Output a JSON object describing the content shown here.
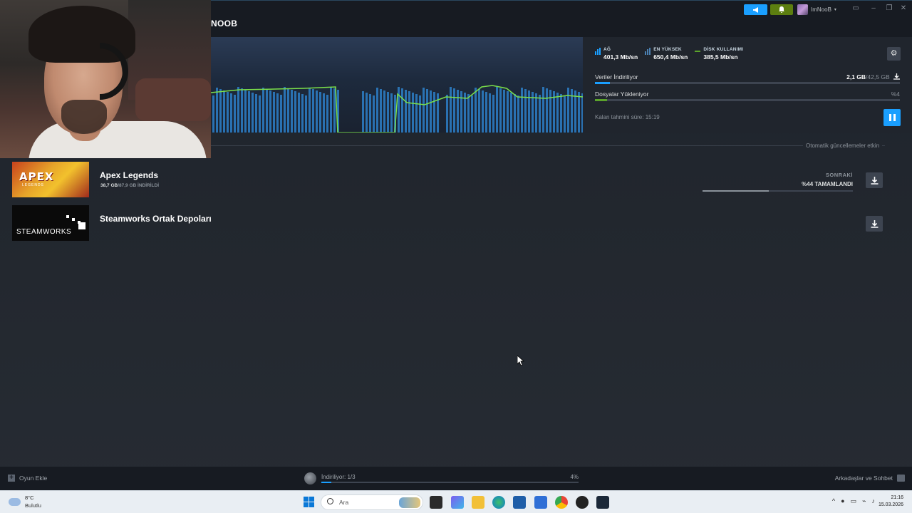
{
  "window": {
    "title": "NOOB",
    "user_name": "ImNooB",
    "colors": {
      "accent": "#1a9fff",
      "green": "#5ba32b",
      "bell_bg": "#5c7e10",
      "bg": "#1b2029"
    }
  },
  "hero": {
    "stats": [
      {
        "label": "AĞ",
        "value": "401,3 Mb/sn",
        "icon": "bar-chart-icon"
      },
      {
        "label": "EN YÜKSEK",
        "value": "650,4 Mb/sn",
        "icon": "bar-chart-icon"
      },
      {
        "label": "DİSK KULLANIMI",
        "value": "385,5 Mb/sn",
        "icon": "line-icon"
      }
    ],
    "download_label": "Veriler İndiriliyor",
    "download_current": "2,1 GB",
    "download_total": "/42,5 GB",
    "download_progress": 0.05,
    "install_label": "Dosyalar Yükleniyor",
    "install_pct": "%4",
    "install_progress": 0.04,
    "eta": "Kalan tahmini süre: 15:19"
  },
  "section": {
    "auto_updates": "Otomatik güncellemeler etkin"
  },
  "queue": [
    {
      "name": "Apex Legends",
      "size_done": "38,7 GB",
      "size_rest": "/87,9 GB İNDİRİLDİ",
      "thumb_text": "APEX",
      "thumb_sub": "LEGENDS",
      "next_label": "SONRAKİ",
      "next_pct": "%44 TAMAMLANDI",
      "progress": 0.44
    },
    {
      "name": "Steamworks Ortak Depoları",
      "thumb_text": "STEAMWORKS"
    }
  ],
  "footer": {
    "add_game": "Oyun Ekle",
    "downloading": "İndiriliyor: 1/3",
    "downloading_pct": "4%",
    "downloading_progress": 0.04,
    "friends": "Arkadaşlar ve Sohbet"
  },
  "taskbar": {
    "temp": "8°C",
    "weather": "Bulutlu",
    "search_placeholder": "Ara",
    "time": "21:16",
    "date": "15.03.2026"
  }
}
